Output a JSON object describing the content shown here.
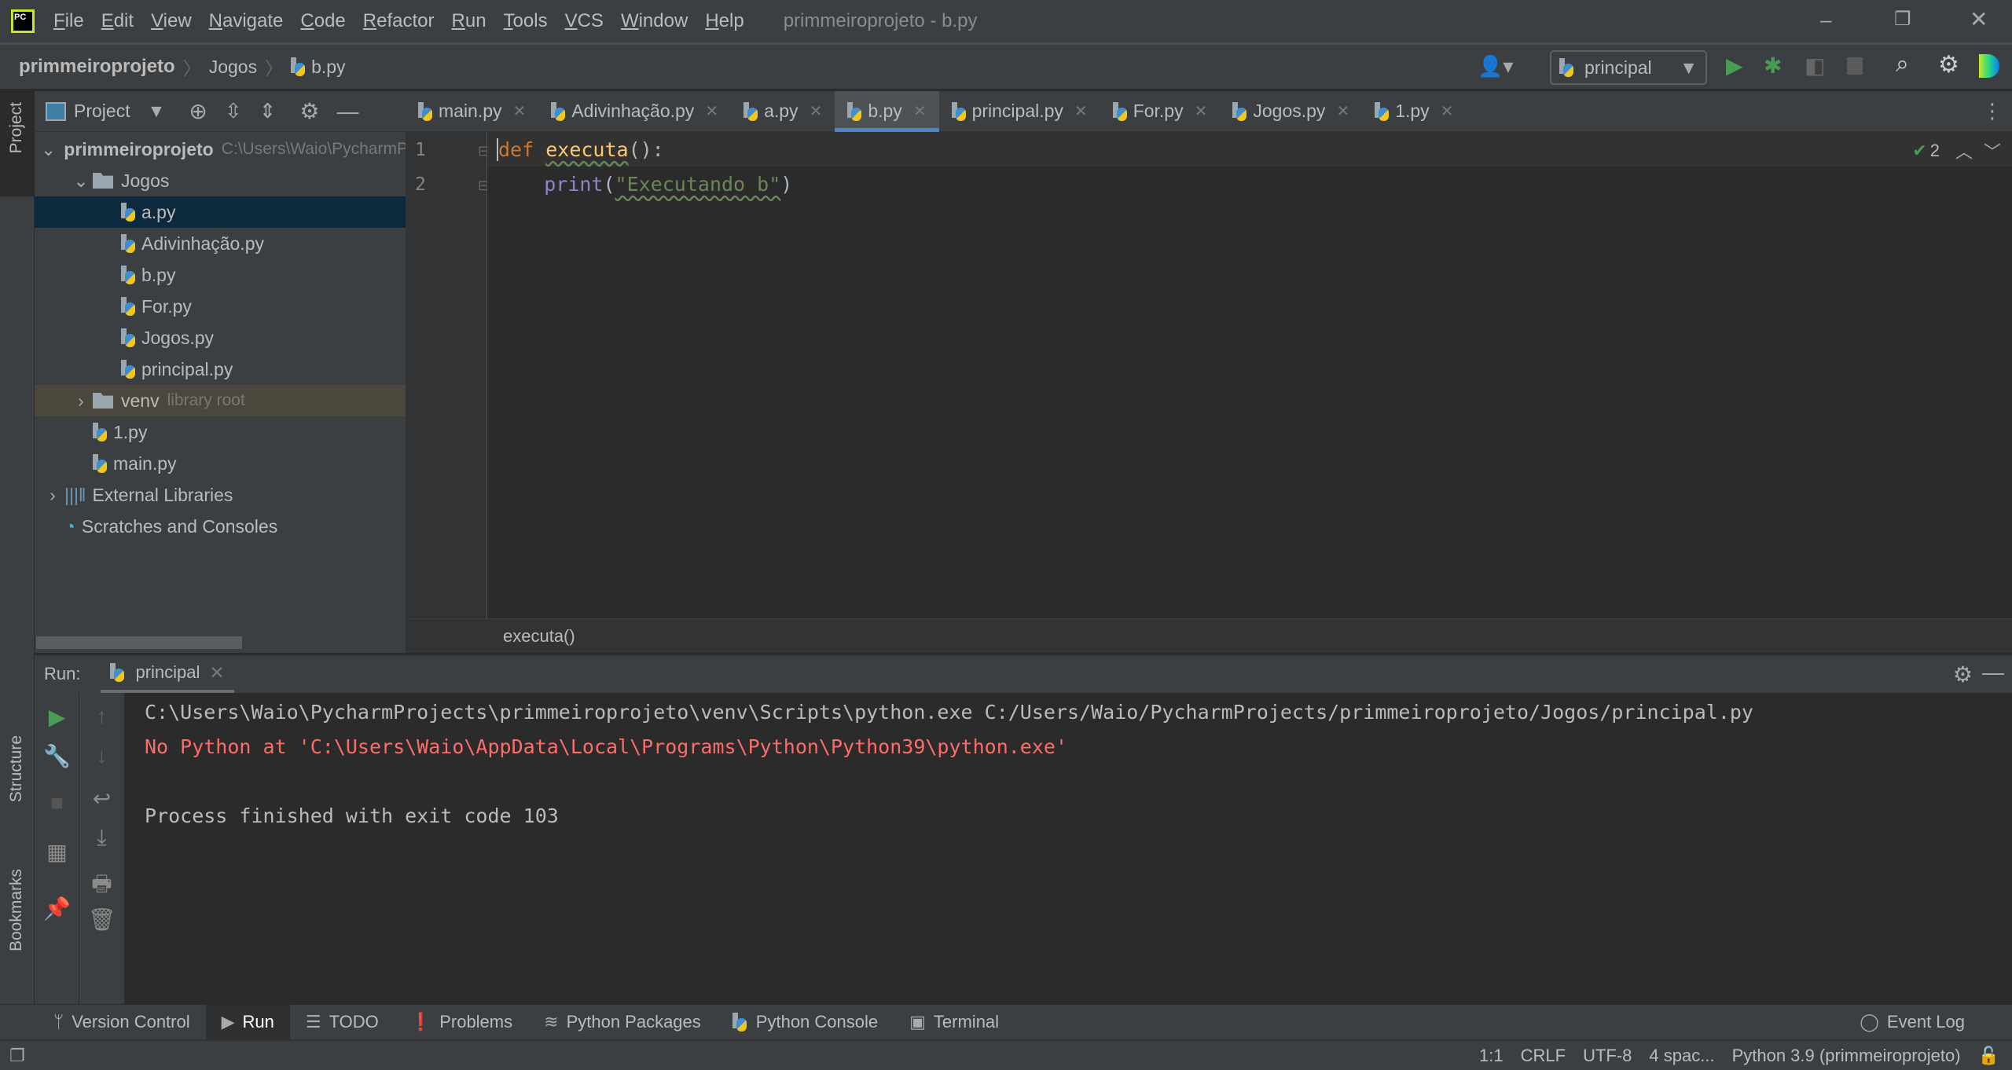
{
  "window": {
    "title": "primmeiroprojeto - b.py",
    "menu": [
      "File",
      "Edit",
      "View",
      "Navigate",
      "Code",
      "Refactor",
      "Run",
      "Tools",
      "VCS",
      "Window",
      "Help"
    ],
    "logo": "PC"
  },
  "navbar": {
    "breadcrumb": [
      "primmeiroprojeto",
      "Jogos",
      "b.py"
    ],
    "run_config": "principal"
  },
  "project_panel": {
    "title": "Project",
    "tree": [
      {
        "label": "primmeiroprojeto",
        "hint": "C:\\Users\\Waio\\PycharmProjects\\primmeiroprojeto",
        "type": "folder",
        "expanded": true,
        "depth": 0
      },
      {
        "label": "Jogos",
        "type": "folder",
        "expanded": true,
        "depth": 1
      },
      {
        "label": "a.py",
        "type": "py",
        "depth": 2,
        "selected": true
      },
      {
        "label": "Adivinhação.py",
        "type": "py",
        "depth": 2
      },
      {
        "label": "b.py",
        "type": "py",
        "depth": 2
      },
      {
        "label": "For.py",
        "type": "py",
        "depth": 2
      },
      {
        "label": "Jogos.py",
        "type": "py",
        "depth": 2
      },
      {
        "label": "principal.py",
        "type": "py",
        "depth": 2
      },
      {
        "label": "venv",
        "hint": "library root",
        "type": "folder",
        "expanded": false,
        "depth": 1
      },
      {
        "label": "1.py",
        "type": "py",
        "depth": 1
      },
      {
        "label": "main.py",
        "type": "py",
        "depth": 1
      },
      {
        "label": "External Libraries",
        "type": "libs",
        "expanded": false,
        "depth": 0
      },
      {
        "label": "Scratches and Consoles",
        "type": "scratch",
        "depth": 0
      }
    ]
  },
  "editor_tabs": [
    {
      "label": "main.py"
    },
    {
      "label": "Adivinhação.py"
    },
    {
      "label": "a.py"
    },
    {
      "label": "b.py",
      "active": true
    },
    {
      "label": "principal.py"
    },
    {
      "label": "For.py"
    },
    {
      "label": "Jogos.py"
    },
    {
      "label": "1.py"
    }
  ],
  "editor": {
    "lines": [
      {
        "num": "1",
        "kw": "def ",
        "fn": "executa",
        "rest": "():"
      },
      {
        "num": "2",
        "indent": "    ",
        "call": "print",
        "open": "(",
        "str": "\"Executando b\"",
        "close": ")"
      }
    ],
    "inspections": "2",
    "breadcrumb": "executa()"
  },
  "side_labels": {
    "project": "Project",
    "structure": "Structure",
    "bookmarks": "Bookmarks"
  },
  "run": {
    "label": "Run:",
    "tab": "principal",
    "output": [
      {
        "text": "C:\\Users\\Waio\\PycharmProjects\\primmeiroprojeto\\venv\\Scripts\\python.exe C:/Users/Waio/PycharmProjects/primmeiroprojeto/Jogos/principal.py",
        "color": "#bbbbbb"
      },
      {
        "text": "No Python at 'C:\\Users\\Waio\\AppData\\Local\\Programs\\Python\\Python39\\python.exe'",
        "color": "#ff6b68"
      },
      {
        "text": "",
        "color": "#bbbbbb"
      },
      {
        "text": "Process finished with exit code 103",
        "color": "#bbbbbb"
      }
    ]
  },
  "bottom_tools": [
    "Version Control",
    "Run",
    "TODO",
    "Problems",
    "Python Packages",
    "Python Console",
    "Terminal"
  ],
  "event_log": "Event Log",
  "status": {
    "position": "1:1",
    "line_sep": "CRLF",
    "encoding": "UTF-8",
    "indent": "4 spac...",
    "interpreter": "Python 3.9 (primmeiroprojeto)"
  },
  "colors": {
    "accent": "#4a88c7",
    "run_green": "#499c54",
    "error": "#ff6b68",
    "keyword": "#cc7832",
    "function": "#ffc66d",
    "string": "#6a8759",
    "builtin": "#8888c6"
  }
}
